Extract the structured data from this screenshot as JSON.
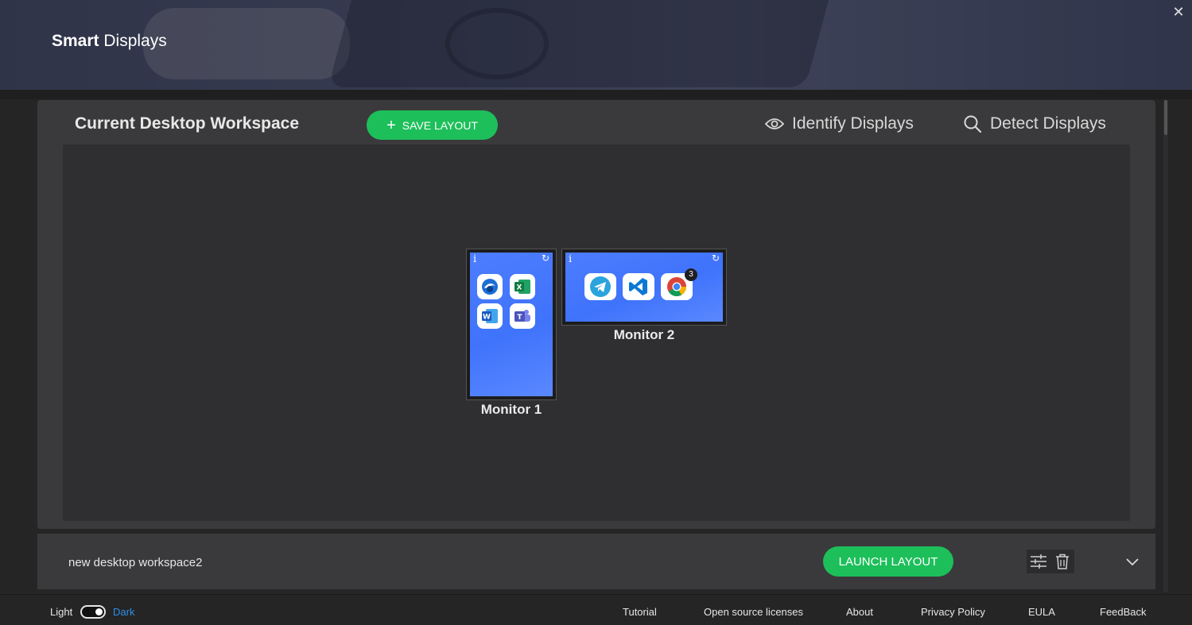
{
  "app": {
    "title_bold": "Smart",
    "title_rest": "Displays",
    "close_glyph": "✕"
  },
  "workspace": {
    "title": "Current Desktop Workspace",
    "save_label": "SAVE LAYOUT",
    "identify_label": "Identify Displays",
    "detect_label": "Detect Displays",
    "monitors": [
      {
        "label": "Monitor 1",
        "info": "i",
        "apps": [
          "thunderbird-icon",
          "excel-icon",
          "word-icon",
          "teams-icon"
        ]
      },
      {
        "label": "Monitor 2",
        "info": "i",
        "apps": [
          "telegram-icon",
          "vscode-icon",
          "chrome-icon"
        ],
        "chrome_badge": "3"
      }
    ]
  },
  "saved_layouts": [
    {
      "name": "new desktop workspace2",
      "launch_label": "LAUNCH LAYOUT"
    }
  ],
  "footer": {
    "light_label": "Light",
    "dark_label": "Dark",
    "links": [
      "Tutorial",
      "Open source licenses",
      "About",
      "Privacy Policy",
      "EULA",
      "FeedBack"
    ]
  },
  "colors": {
    "accent_green": "#1dbf5a",
    "monitor_blue": "#4d7dff",
    "dark_link": "#2e8fe8"
  }
}
